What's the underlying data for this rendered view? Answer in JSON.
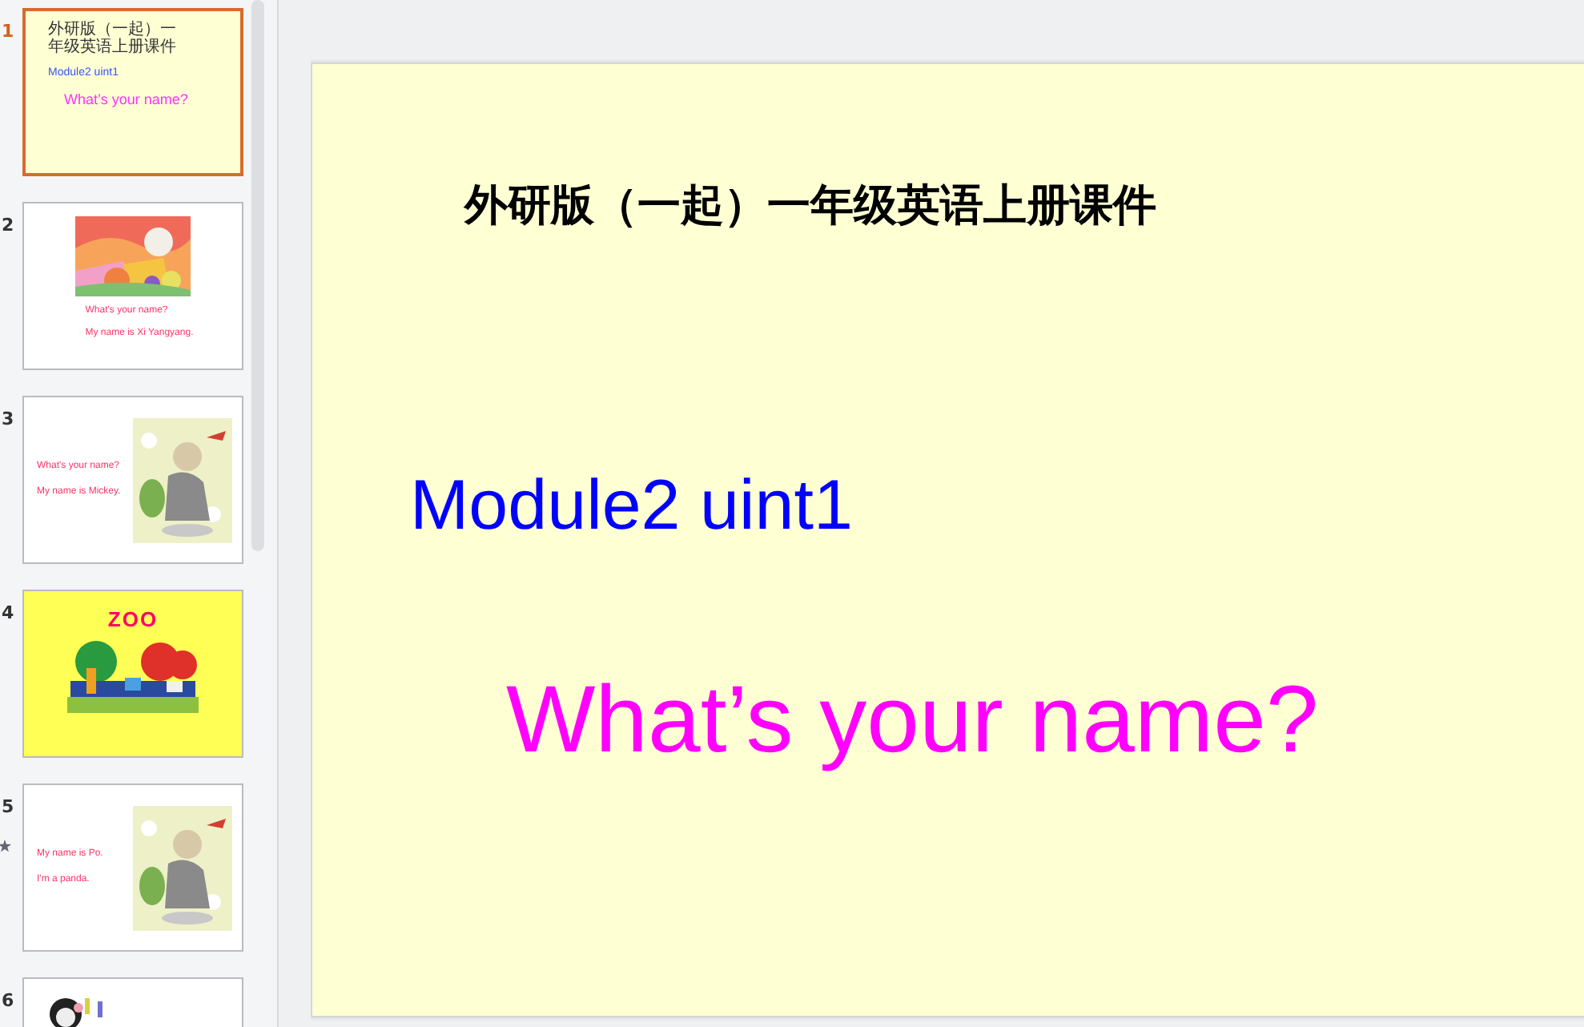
{
  "slides": [
    {
      "number": "1",
      "selected": true,
      "starred": false,
      "kind": "title",
      "texts": [
        {
          "text": "外研版（一起）一年级英语上册课件",
          "color": "#333333"
        },
        {
          "text": "Module2 uint1",
          "color": "#3355ff"
        },
        {
          "text": "What’s your name?",
          "color": "#ff33ff"
        }
      ]
    },
    {
      "number": "2",
      "selected": false,
      "starred": false,
      "kind": "picture_top",
      "texts": [
        {
          "text": "What's your name?",
          "color": "#ff3366"
        },
        {
          "text": "My name is Xi Yangyang.",
          "color": "#ff3366"
        }
      ]
    },
    {
      "number": "3",
      "selected": false,
      "starred": false,
      "kind": "picture_right",
      "texts": [
        {
          "text": "What's your name?",
          "color": "#ff3366"
        },
        {
          "text": "My name is Mickey.",
          "color": "#ff3366"
        }
      ]
    },
    {
      "number": "4",
      "selected": false,
      "starred": false,
      "kind": "zoo",
      "texts": [
        {
          "text": "ZOO",
          "color": "#ff0066"
        }
      ]
    },
    {
      "number": "5",
      "selected": false,
      "starred": true,
      "kind": "picture_right",
      "texts": [
        {
          "text": "My name is Po.",
          "color": "#ff3366"
        },
        {
          "text": "I'm a panda.",
          "color": "#ff3366"
        }
      ]
    },
    {
      "number": "6",
      "selected": false,
      "starred": false,
      "kind": "picture_left"
    }
  ],
  "editor": {
    "texts": [
      {
        "kind": "title",
        "text": "外研版（一起）一年级英语上册课件",
        "color": "#000000"
      },
      {
        "kind": "subtitle",
        "text": "Module2 uint1",
        "color": "#0000ff"
      },
      {
        "kind": "heading",
        "text": "What’s your name?",
        "color": "#ff00ff"
      }
    ]
  }
}
